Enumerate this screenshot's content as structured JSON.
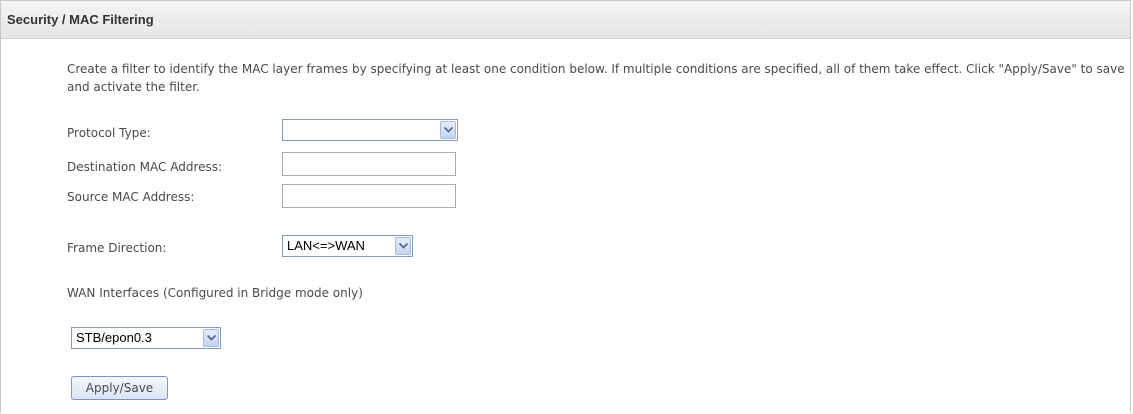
{
  "header": {
    "title": "Security / MAC Filtering"
  },
  "description": "Create a filter to identify the MAC layer frames by specifying at least one condition below. If multiple conditions are specified, all of them take effect. Click \"Apply/Save\" to save and activate the filter.",
  "form": {
    "protocol_type": {
      "label": "Protocol Type:",
      "value": ""
    },
    "destination_mac": {
      "label": "Destination MAC Address:",
      "value": ""
    },
    "source_mac": {
      "label": "Source MAC Address:",
      "value": ""
    },
    "frame_direction": {
      "label": "Frame Direction:",
      "value": "LAN<=>WAN"
    },
    "wan_interfaces": {
      "label": "WAN Interfaces (Configured in Bridge mode only)",
      "value": "STB/epon0.3"
    }
  },
  "actions": {
    "apply_save_label": "Apply/Save"
  },
  "icons": {
    "dropdown": "chevron-down-icon"
  },
  "colors": {
    "title_bar": "#e6e6e6",
    "text": "#4a4a4a",
    "field_border": "#a5acb5",
    "select_border": "#7f9db9",
    "button_border": "#7d95c8"
  }
}
